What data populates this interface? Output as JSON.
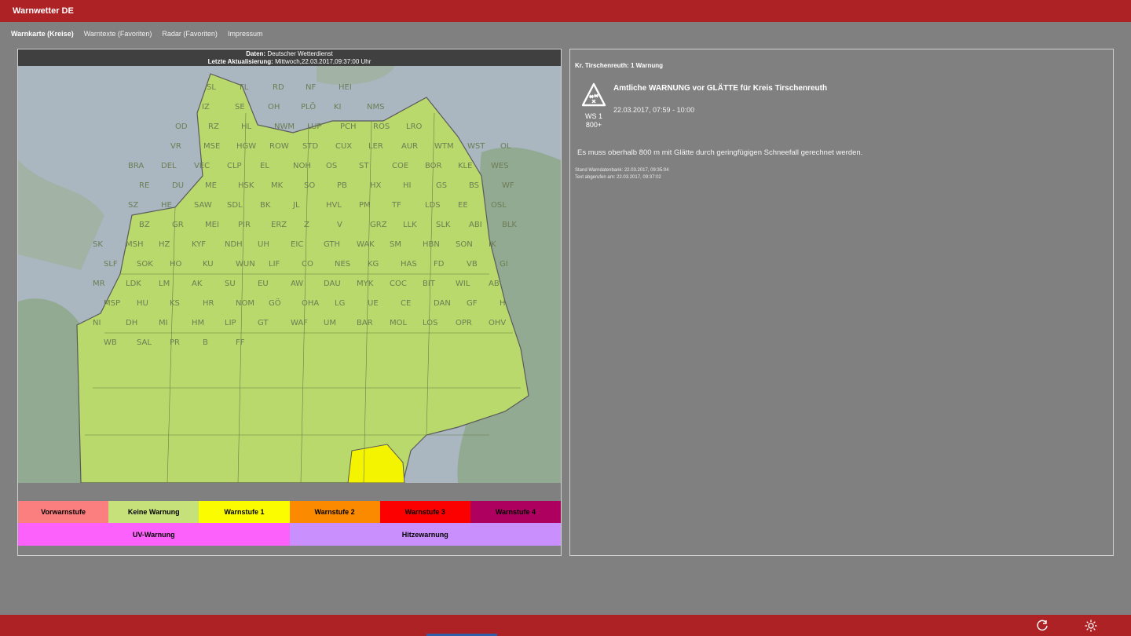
{
  "app": {
    "title": "Warnwetter DE"
  },
  "nav": {
    "tabs": [
      {
        "label": "Warnkarte (Kreise)"
      },
      {
        "label": "Warntexte (Favoriten)"
      },
      {
        "label": "Radar (Favoriten)"
      },
      {
        "label": "Impressum"
      }
    ]
  },
  "map": {
    "source_label": "Daten:",
    "source_value": "Deutscher Wetterdienst",
    "update_label": "Letzte Aktualisierung:",
    "update_value": "Mittwoch,22.03.2017,09:37:00 Uhr",
    "district_labels": [
      "SL",
      "FL",
      "RD",
      "NF",
      "HEI",
      "IZ",
      "SE",
      "OH",
      "PLÖ",
      "KI",
      "NMS",
      "OD",
      "RZ",
      "HL",
      "NWM",
      "LUP",
      "PCH",
      "ROS",
      "LRO",
      "VR",
      "MSE",
      "HGW",
      "ROW",
      "STD",
      "CUX",
      "LER",
      "AUR",
      "WTM",
      "WST",
      "OL",
      "BRA",
      "DEL",
      "VEC",
      "CLP",
      "EL",
      "NOH",
      "OS",
      "ST",
      "COE",
      "BOR",
      "KLE",
      "WES",
      "RE",
      "DU",
      "ME",
      "HSK",
      "MK",
      "SO",
      "PB",
      "HX",
      "HI",
      "GS",
      "BS",
      "WF",
      "SZ",
      "HE",
      "SAW",
      "SDL",
      "BK",
      "JL",
      "HVL",
      "PM",
      "TF",
      "LDS",
      "EE",
      "OSL",
      "BZ",
      "GR",
      "MEI",
      "PIR",
      "ERZ",
      "Z",
      "V",
      "GRZ",
      "LLK",
      "SLK",
      "ABI",
      "BLK",
      "SK",
      "MSH",
      "HZ",
      "KYF",
      "NDH",
      "UH",
      "EIC",
      "GTH",
      "WAK",
      "SM",
      "HBN",
      "SON",
      "IK",
      "SLF",
      "SOK",
      "HO",
      "KU",
      "WUN",
      "LIF",
      "CO",
      "NES",
      "KG",
      "HAS",
      "FD",
      "VB",
      "GI",
      "MR",
      "LDK",
      "LM",
      "AK",
      "SU",
      "EU",
      "AW",
      "DAU",
      "MYK",
      "COC",
      "BIT",
      "WIL",
      "AB",
      "MSP",
      "HU",
      "KS",
      "HR",
      "NOM",
      "GÖ",
      "OHA",
      "LG",
      "UE",
      "CE",
      "DAN",
      "GF",
      "H",
      "NI",
      "DH",
      "MI",
      "HM",
      "LIP",
      "GT",
      "WAF",
      "UM",
      "BAR",
      "MOL",
      "LOS",
      "OPR",
      "OHV",
      "WB",
      "SAL",
      "PR",
      "B",
      "FF"
    ]
  },
  "legend": {
    "row1": [
      {
        "label": "Vorwarnstufe",
        "color": "#fc7f7f"
      },
      {
        "label": "Keine Warnung",
        "color": "#c6e17a"
      },
      {
        "label": "Warnstufe 1",
        "color": "#fcfc00"
      },
      {
        "label": "Warnstufe 2",
        "color": "#fc8a00"
      },
      {
        "label": "Warnstufe 3",
        "color": "#fc0000"
      },
      {
        "label": "Warnstufe 4",
        "color": "#ad005f"
      }
    ],
    "row2": [
      {
        "label": "UV-Warnung",
        "color": "#fc61fc"
      },
      {
        "label": "Hitzewarnung",
        "color": "#c98ffc"
      }
    ]
  },
  "detail": {
    "heading": "Kr. Tirschenreuth: 1 Warnung",
    "icon": "glatte-snow-warning-icon",
    "icon_code": "WS 1",
    "icon_altitude": "800+",
    "title": "Amtliche WARNUNG vor GLÄTTE für Kreis Tirschenreuth",
    "time": "22.03.2017, 07:59 - 10:00",
    "text": "Es muss oberhalb 800 m mit Glätte durch geringfügigen Schneefall gerechnet werden.",
    "meta_db": "Stand Warndatenbank: 22.03.2017, 09:35:04",
    "meta_fetch": "Text abgerufen am: 22.03.2017, 09:37:02"
  },
  "bottombar": {
    "icons": [
      "refresh-icon",
      "settings-icon"
    ]
  },
  "colors": {
    "accent": "#ad2225",
    "background": "#808080",
    "map_green": "#b9d96c",
    "map_yellow": "#f4f400"
  }
}
